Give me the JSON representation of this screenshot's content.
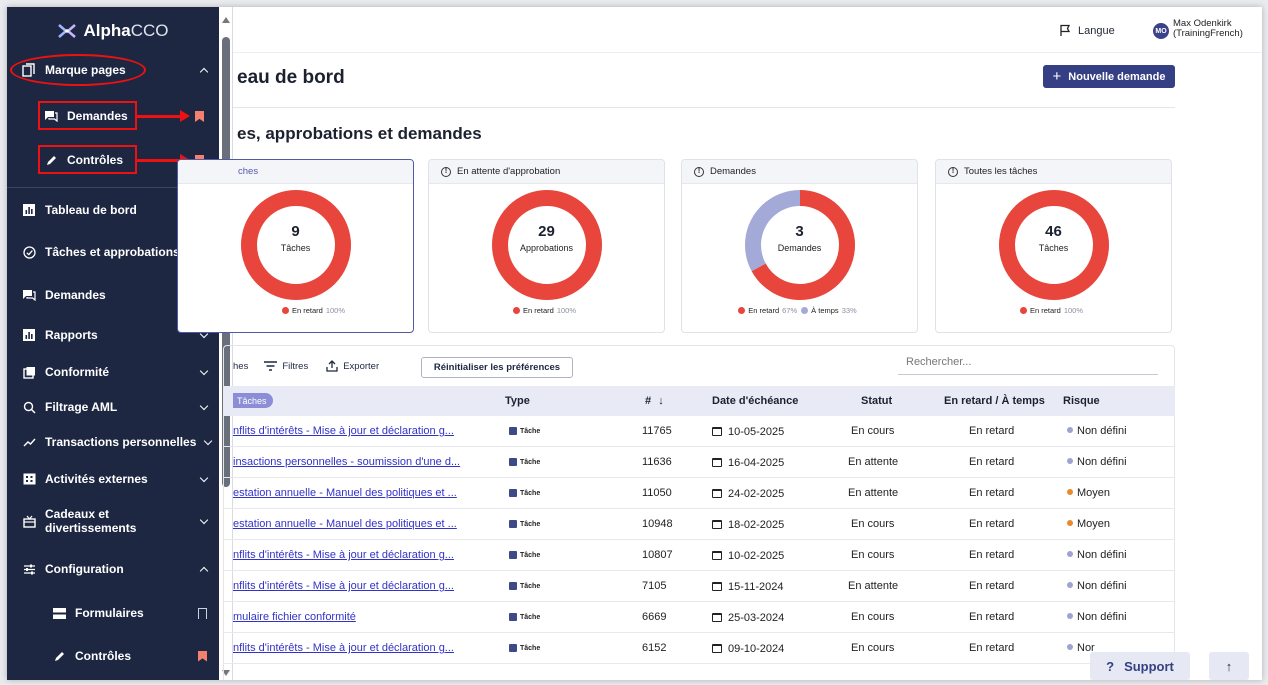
{
  "app": {
    "logo_main": "Alpha",
    "logo_sub": "CCO"
  },
  "topbar": {
    "language": "Langue",
    "avatar_initials": "MO",
    "user_name": "Max Odenkirk",
    "user_sub": "(TrainingFrench)"
  },
  "sidebar": {
    "bookmarks_label": "Marque pages",
    "bookmarks_sub": [
      {
        "label": "Demandes",
        "icon": "chat-icon"
      },
      {
        "label": "Contrôles",
        "icon": "pencil-icon"
      }
    ],
    "items": [
      {
        "label": "Tableau de bord",
        "icon": "chart-icon",
        "tail": "bookmark-outline"
      },
      {
        "label": "Tâches et approbations",
        "icon": "check-circle-icon",
        "tail": "bookmark-outline"
      },
      {
        "label": "Demandes",
        "icon": "chat-icon",
        "tail": "bookmark-filled"
      },
      {
        "label": "Rapports",
        "icon": "chart-icon",
        "tail": "chevron-down"
      },
      {
        "label": "Conformité",
        "icon": "copy-icon",
        "tail": "chevron-down"
      },
      {
        "label": "Filtrage AML",
        "icon": "search-icon",
        "tail": "chevron-down"
      },
      {
        "label": "Transactions personnelles",
        "icon": "trend-icon",
        "tail": "chevron-down"
      },
      {
        "label": "Activités externes",
        "icon": "building-icon",
        "tail": "chevron-down"
      },
      {
        "label": "Cadeaux et",
        "label2": "divertissements",
        "icon": "gift-icon",
        "tail": "chevron-down"
      },
      {
        "label": "Configuration",
        "icon": "sliders-icon",
        "tail": "chevron-up"
      },
      {
        "label": "Formulaires",
        "icon": "form-icon",
        "tail": "bookmark-outline"
      },
      {
        "label": "Contrôles",
        "icon": "pencil-icon",
        "tail": "bookmark-filled"
      }
    ]
  },
  "main": {
    "page_title": "eau de bord",
    "new_button": "Nouvelle demande",
    "section_title": "es, approbations et demandes",
    "cards": [
      {
        "header": "ches",
        "value": "9",
        "label": "Tâches",
        "legend": [
          {
            "name": "En retard",
            "pct": "100%",
            "color": "#e8453c"
          }
        ]
      },
      {
        "header": "En attente d'approbation",
        "value": "29",
        "label": "Approbations",
        "legend": [
          {
            "name": "En retard",
            "pct": "100%",
            "color": "#e8453c"
          }
        ]
      },
      {
        "header": "Demandes",
        "value": "3",
        "label": "Demandes",
        "legend": [
          {
            "name": "En retard",
            "pct": "67%",
            "color": "#e8453c"
          },
          {
            "name": "À temps",
            "pct": "33%",
            "color": "#a3aad8"
          }
        ]
      },
      {
        "header": "Toutes les tâches",
        "value": "46",
        "label": "Tâches",
        "legend": [
          {
            "name": "En retard",
            "pct": "100%",
            "color": "#e8453c"
          }
        ]
      }
    ],
    "toolbar": {
      "t1": "hes",
      "filters": "Filtres",
      "export": "Exporter",
      "reset": "Réinitialiser les préférences",
      "search_placeholder": "Rechercher..."
    },
    "table": {
      "chip": "Tâches",
      "headers": {
        "type": "Type",
        "num": "#",
        "due": "Date d'échéance",
        "status": "Statut",
        "late": "En retard / À temps",
        "risk": "Risque"
      },
      "rows": [
        {
          "name": "nflits d'intérêts - Mise à jour et déclaration g...",
          "type": "Tâche",
          "num": "11765",
          "due": "10-05-2025",
          "status": "En cours",
          "late": "En retard",
          "risk": "Non défini",
          "risk_color": "#9ea3cf"
        },
        {
          "name": "insactions personnelles - soumission d'une d...",
          "type": "Tâche",
          "num": "11636",
          "due": "16-04-2025",
          "status": "En attente",
          "late": "En retard",
          "risk": "Non défini",
          "risk_color": "#9ea3cf"
        },
        {
          "name": "estation annuelle - Manuel des politiques et ...",
          "type": "Tâche",
          "num": "11050",
          "due": "24-02-2025",
          "status": "En attente",
          "late": "En retard",
          "risk": "Moyen",
          "risk_color": "#e98a2a"
        },
        {
          "name": "estation annuelle - Manuel des politiques et ...",
          "type": "Tâche",
          "num": "10948",
          "due": "18-02-2025",
          "status": "En cours",
          "late": "En retard",
          "risk": "Moyen",
          "risk_color": "#e98a2a"
        },
        {
          "name": "nflits d'intérêts - Mise à jour et déclaration g...",
          "type": "Tâche",
          "num": "10807",
          "due": "10-02-2025",
          "status": "En cours",
          "late": "En retard",
          "risk": "Non défini",
          "risk_color": "#9ea3cf"
        },
        {
          "name": "nflits d'intérêts - Mise à jour et déclaration g...",
          "type": "Tâche",
          "num": "7105",
          "due": "15-11-2024",
          "status": "En attente",
          "late": "En retard",
          "risk": "Non défini",
          "risk_color": "#9ea3cf"
        },
        {
          "name": "mulaire fichier conformité",
          "type": "Tâche",
          "num": "6669",
          "due": "25-03-2024",
          "status": "En cours",
          "late": "En retard",
          "risk": "Non défini",
          "risk_color": "#9ea3cf"
        },
        {
          "name": "nflits d'intérêts - Mise à jour et déclaration g...",
          "type": "Tâche",
          "num": "6152",
          "due": "09-10-2024",
          "status": "En cours",
          "late": "En retard",
          "risk": "Nor",
          "risk_color": "#9ea3cf"
        }
      ]
    },
    "support": "Support"
  }
}
